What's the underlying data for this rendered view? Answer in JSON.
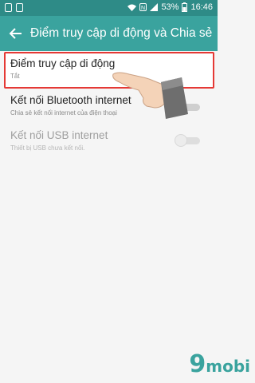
{
  "status_bar": {
    "battery_percent": "53%",
    "time": "16:46"
  },
  "app_bar": {
    "title": "Điểm truy cập di động và Chia sẻ ..."
  },
  "items": [
    {
      "title": "Điểm truy cập di động",
      "subtitle": "Tắt",
      "highlighted": true
    },
    {
      "title": "Kết nối Bluetooth internet",
      "subtitle": "Chia sẻ kết nối internet của điện thoại",
      "toggle_on": false,
      "enabled": true
    },
    {
      "title": "Kết nối USB internet",
      "subtitle": "Thiết bị USB chưa kết nối.",
      "toggle_on": false,
      "enabled": false
    }
  ],
  "watermark": {
    "digit": "9",
    "text": "mobi"
  },
  "colors": {
    "status_bar": "#2e8b87",
    "app_bar": "#3aa39e",
    "highlight_border": "#e53935"
  }
}
